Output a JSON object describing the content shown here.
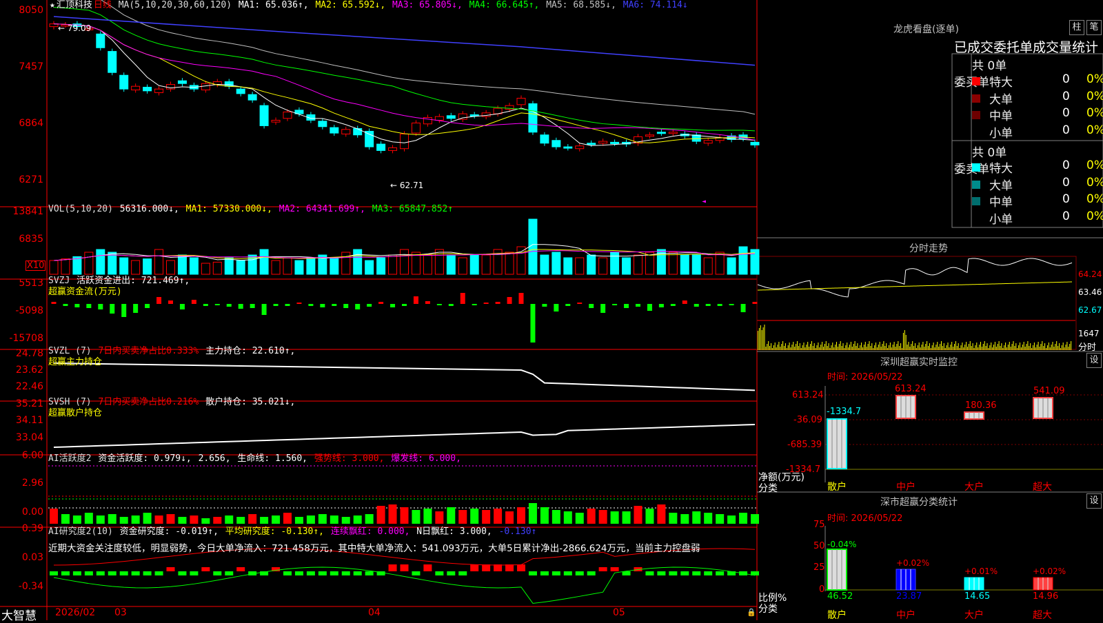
{
  "app": {
    "brand": "大智慧"
  },
  "kline_header": {
    "star": "★",
    "stock_name": "汇顶科技",
    "period": "日线",
    "ma_def": "MA(5,10,20,30,60,120)",
    "ma1": "MA1: 65.036↑,",
    "ma2": "MA2: 65.592↓,",
    "ma3": "MA3: 65.805↓,",
    "ma4": "MA4: 66.645↑,",
    "ma5": "MA5: 68.585↓,",
    "ma6": "MA6: 74.114↓"
  },
  "vol_header": {
    "def": "VOL(5,10,20)",
    "val": "56316.000↓,",
    "ma1": "MA1: 57330.000↓,",
    "ma2": "MA2: 64341.699↑,",
    "ma3": "MA3: 65847.852↑",
    "x10": "X10"
  },
  "svzj_header": {
    "def": "SVZJ",
    "val": "活跃资金进出: 721.469↑,",
    "sub": "超赢资金流(万元)"
  },
  "svzl_header": {
    "def": "SVZL (7)",
    "val1": "7日内买卖净占比0.333%",
    "val2": "主力持仓: 22.610↑,",
    "sub": "超赢主力持仓"
  },
  "svsh_header": {
    "def": "SVSH (7)",
    "val1": "7日内买卖净占比0.216%",
    "val2": "散户持仓: 35.021↓,",
    "sub": "超赢散户持仓"
  },
  "ai1_header": {
    "def": "AI活跃度2",
    "v1": "资金活跃度: 0.979↓,",
    "v2": "2.656,",
    "v3": "生命线: 1.560,",
    "v4": "强势线: 3.000,",
    "v5": "爆发线: 6.000,"
  },
  "ai2_header": {
    "def": "AI研究度2(10)",
    "v1": "资金研究度: -0.019↑,",
    "v2": "平均研究度: -0.130↑,",
    "v3": "连续飘红: 0.000,",
    "v4": "N日飘红: 3.000,",
    "v5": "-0.130↑"
  },
  "ai2_comment": "近期大资金关注度较低，明显弱势，今日大单净流入：721.458万元，其中特大单净流入：541.093万元，大单5日累计净出-2866.624万元，当前主力控盘弱",
  "y_axes": {
    "price": [
      "8050",
      "7457",
      "6864",
      "6271"
    ],
    "vol": [
      "13841",
      "6835"
    ],
    "svzj": [
      "5513",
      "-5098",
      "-15708"
    ],
    "svzl": [
      "24.78",
      "23.62",
      "22.46"
    ],
    "svsh": [
      "35.21",
      "34.11",
      "33.04"
    ],
    "ai1": [
      "6.00",
      "2.96",
      "0.00"
    ],
    "ai2": [
      "0.39",
      "0.03",
      "-0.34"
    ]
  },
  "x_axis": {
    "labels": [
      "2026/02",
      "03",
      "04",
      "05"
    ]
  },
  "annotations": {
    "high": "79.09",
    "low": "62.71"
  },
  "dragon": {
    "title": "龙虎看盘(逐单)",
    "btn1": "柱",
    "btn2": "笔",
    "subtitle": "已成交委托单成交量统计",
    "buy_side": "委买单",
    "sell_side": "委卖单",
    "buy_total": "共 0单",
    "sell_total": "共 0单",
    "buy_rows": [
      {
        "name": "特大",
        "count": "0",
        "pct": "0%",
        "color": "#ff0000"
      },
      {
        "name": "大单",
        "count": "0",
        "pct": "0%",
        "color": "#8b0000"
      },
      {
        "name": "中单",
        "count": "0",
        "pct": "0%",
        "color": "#6e0000"
      },
      {
        "name": "小单",
        "count": "0",
        "pct": "0%",
        "color": ""
      }
    ],
    "sell_rows": [
      {
        "name": "特大",
        "count": "0",
        "pct": "0%",
        "color": "#00ffff"
      },
      {
        "name": "大单",
        "count": "0",
        "pct": "0%",
        "color": "#008b8b"
      },
      {
        "name": "中单",
        "count": "0",
        "pct": "0%",
        "color": "#006e6e"
      },
      {
        "name": "小单",
        "count": "0",
        "pct": "0%",
        "color": ""
      }
    ]
  },
  "intraday": {
    "title": "分时走势",
    "prices": [
      "64.24",
      "63.46",
      "62.67"
    ],
    "vol_top": "1647",
    "vol_label": "分时"
  },
  "monitor": {
    "title": "深圳超赢实时监控",
    "set_btn": "设",
    "time": "时间: 2026/05/22",
    "y_labels": [
      "613.24",
      "-36.09",
      "-685.39",
      "-1334.7"
    ],
    "net_label": "净额(万元)",
    "cat_label": "分类",
    "categories": [
      "散户",
      "中户",
      "大户",
      "超大"
    ],
    "bar_values": [
      "-1334.7",
      "613.24",
      "180.36",
      "541.09"
    ]
  },
  "classify": {
    "title": "深市超赢分类统计",
    "set_btn": "设",
    "time": "时间: 2026/05/22",
    "y_labels": [
      "75",
      "50",
      "25",
      "0"
    ],
    "ratio_label": "比例%",
    "cat_label": "分类",
    "categories": [
      "散户",
      "中户",
      "大户",
      "超大"
    ],
    "pcts": [
      "46.52",
      "23.87",
      "14.65",
      "14.96"
    ],
    "changes": [
      "-0.04%",
      "+0.02%",
      "+0.01%",
      "+0.02%"
    ]
  },
  "colors": {
    "up": "#ff0000",
    "down": "#00ffff",
    "ma1": "#ffffff",
    "ma2": "#ffff00",
    "ma3": "#ff00ff",
    "ma4": "#00ff00",
    "ma5": "#c0c0c0",
    "ma6": "#4040ff"
  }
}
